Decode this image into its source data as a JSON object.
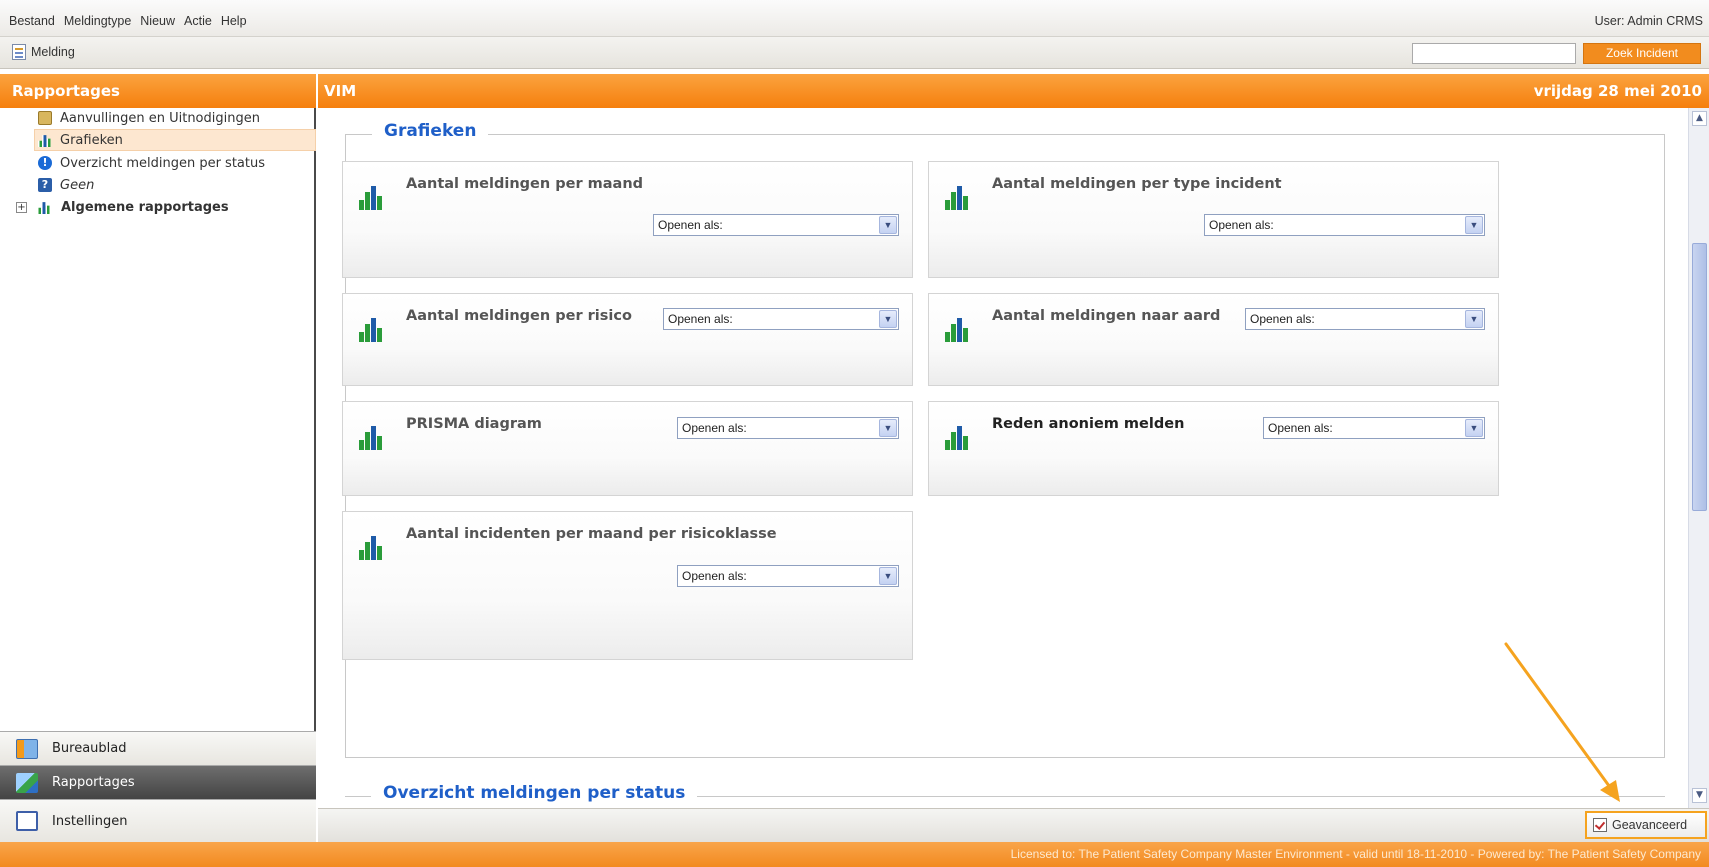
{
  "menu": {
    "items": [
      "Bestand",
      "Meldingtype",
      "Nieuw",
      "Actie",
      "Help"
    ],
    "user": "User: Admin CRMS"
  },
  "toolbar": {
    "melding_label": "Melding",
    "search_value": "",
    "search_button": "Zoek Incident"
  },
  "left_header": "Rapportages",
  "right_header": {
    "title": "VIM",
    "date": "vrijdag 28 mei 2010"
  },
  "tree": [
    {
      "label": "Aanvullingen en Uitnodigingen",
      "icon": "clipboard-icon"
    },
    {
      "label": "Grafieken",
      "icon": "chart-icon",
      "selected": true
    },
    {
      "label": "Overzicht meldingen per status",
      "icon": "info-icon"
    },
    {
      "label": "Geen",
      "icon": "help-icon"
    },
    {
      "label": "Algemene rapportages",
      "icon": "chart-icon",
      "expand": "+"
    }
  ],
  "nav": {
    "bureaublad": "Bureaublad",
    "rapportages": "Rapportages",
    "instellingen": "Instellingen"
  },
  "section1": "Grafieken",
  "section2": "Overzicht meldingen per status",
  "select_placeholder": "Openen als:",
  "cards": [
    {
      "title": "Aantal meldingen per maand"
    },
    {
      "title": "Aantal meldingen per type incident"
    },
    {
      "title": "Aantal meldingen per risico"
    },
    {
      "title": "Aantal meldingen naar aard"
    },
    {
      "title": "PRISMA diagram"
    },
    {
      "title": "Reden anoniem melden"
    },
    {
      "title": "Aantal incidenten per maand per risicoklasse"
    }
  ],
  "advanced_button": "Geavanceerd",
  "license": "Licensed to: The Patient Safety Company Master Environment - valid until 18-11-2010 - Powered by: The Patient Safety Company",
  "colors": {
    "accent_orange": "#f57f0d",
    "link_blue": "#1f5fc8",
    "annotation_arrow": "#f5a31f"
  }
}
